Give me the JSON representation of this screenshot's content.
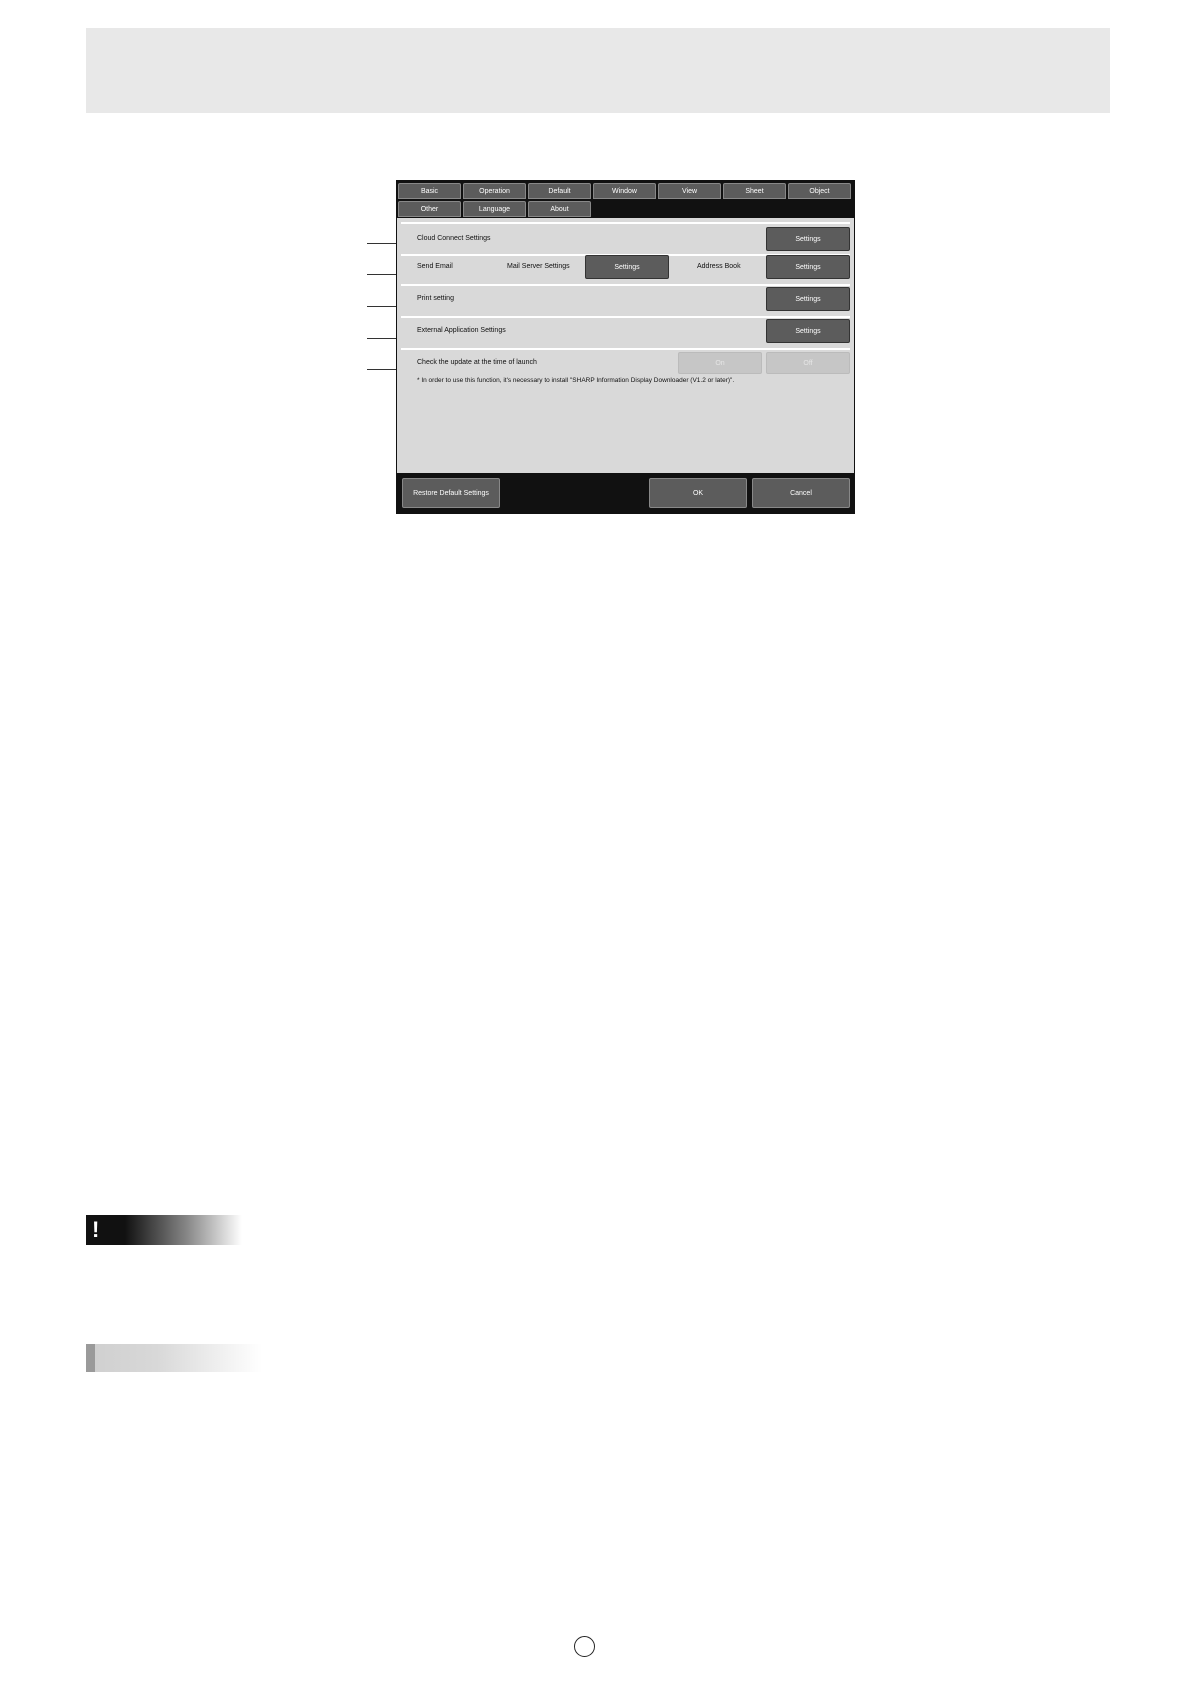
{
  "dialog": {
    "tabs_row1": [
      "Basic",
      "Operation",
      "Default",
      "Window",
      "View",
      "Sheet",
      "Object"
    ],
    "tabs_row2": [
      "Other",
      "Language",
      "About"
    ],
    "rows": {
      "cloud": {
        "label": "Cloud Connect Settings",
        "button": "Settings"
      },
      "email": {
        "label": "Send Email",
        "mail_server_label": "Mail Server Settings",
        "mail_server_button": "Settings",
        "address_book_label": "Address Book",
        "address_book_button": "Settings"
      },
      "print": {
        "label": "Print setting",
        "button": "Settings"
      },
      "external": {
        "label": "External Application Settings",
        "button": "Settings"
      },
      "update": {
        "label": "Check the update at the time of launch",
        "on": "On",
        "off": "Off"
      }
    },
    "note": "* In order to use this function, it's necessary to install \"SHARP Information Display Downloader (V1.2 or later)\".",
    "footer": {
      "restore": "Restore Default Settings",
      "ok": "OK",
      "cancel": "Cancel"
    }
  },
  "page": {
    "caution_mark": "!"
  }
}
